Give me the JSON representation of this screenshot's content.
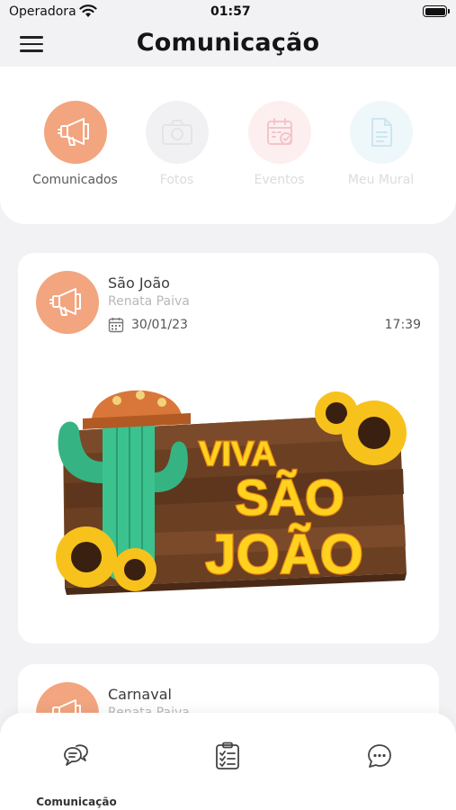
{
  "status_bar": {
    "carrier": "Operadora",
    "time": "01:57"
  },
  "header": {
    "title": "Comunicação"
  },
  "categories": [
    {
      "label": "Comunicados",
      "icon": "megaphone-icon",
      "active": true
    },
    {
      "label": "Fotos",
      "icon": "camera-icon",
      "active": false
    },
    {
      "label": "Eventos",
      "icon": "calendar-icon",
      "active": false
    },
    {
      "label": "Meu Mural",
      "icon": "document-icon",
      "active": false
    }
  ],
  "posts": [
    {
      "title": "São João",
      "author": "Renata Paiva",
      "date": "30/01/23",
      "time": "17:39",
      "image": {
        "line1": "VIVA",
        "line2": "SÃO",
        "line3": "JOÃO"
      }
    },
    {
      "title": "Carnaval",
      "author": "Renata Paiva"
    }
  ],
  "bottom_nav": [
    {
      "label": "Comunicação",
      "icon": "chat-bubbles-icon",
      "active": true
    },
    {
      "label": "",
      "icon": "checklist-icon",
      "active": false
    },
    {
      "label": "",
      "icon": "message-icon",
      "active": false
    }
  ],
  "colors": {
    "accent": "#f2a57f",
    "background": "#f2f2f4",
    "card": "#ffffff"
  }
}
